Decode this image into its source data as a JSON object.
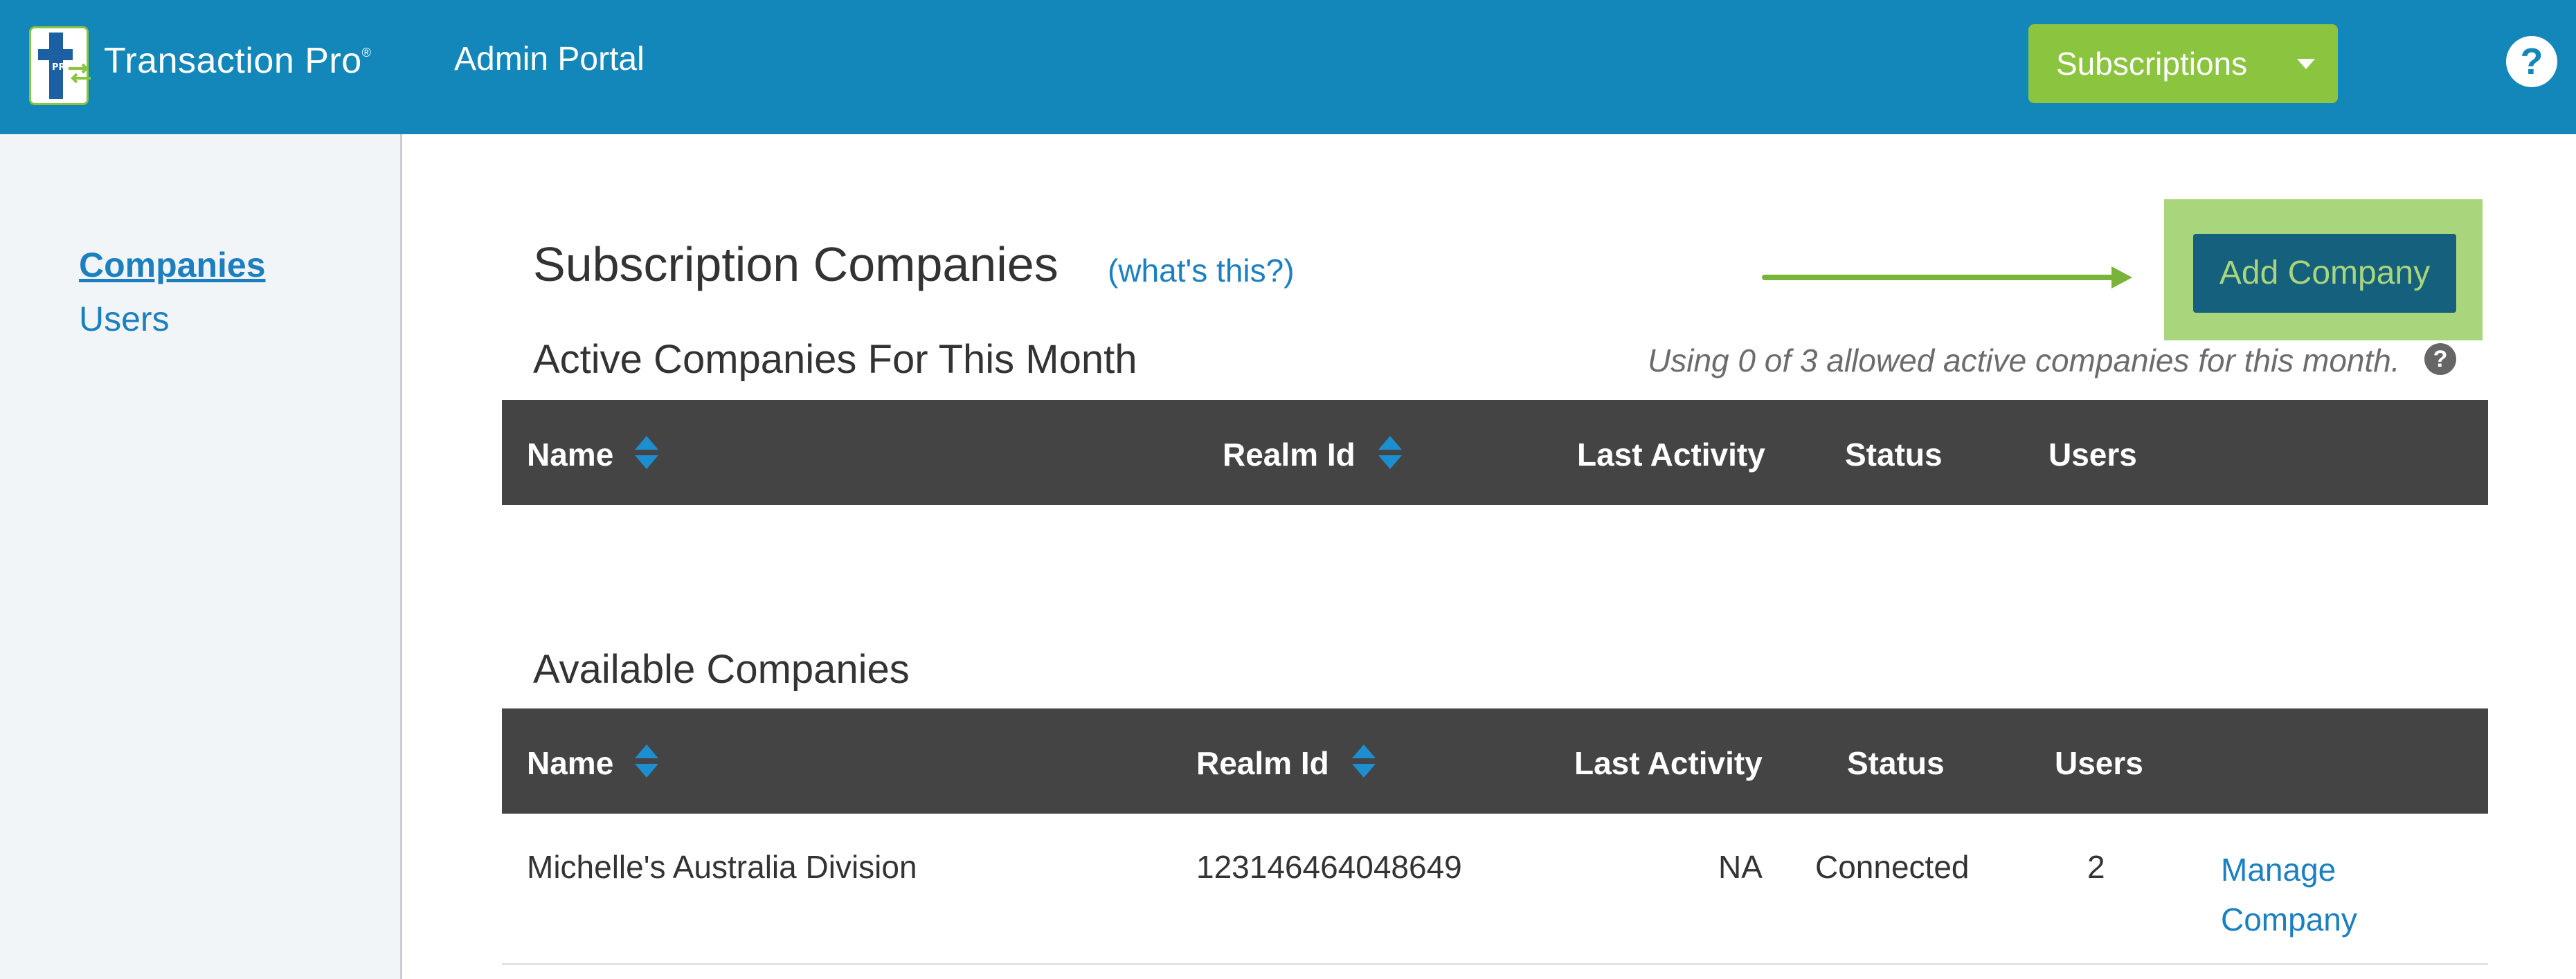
{
  "header": {
    "logo_text": "Transaction Pro",
    "logo_mark_text": "PRO",
    "trademark": "®",
    "portal_title": "Admin Portal",
    "subscriptions_label": "Subscriptions",
    "help_label": "?",
    "bar_color": "#1487ba",
    "accent_color": "#8bc43f"
  },
  "sidebar": {
    "items": [
      {
        "label": "Companies",
        "active": true
      },
      {
        "label": "Users",
        "active": false
      }
    ]
  },
  "main": {
    "title": "Subscription Companies",
    "whats_this": "(what's this?)",
    "add_company_label": "Add Company",
    "active_section": {
      "title": "Active Companies For This Month",
      "usage_note": "Using 0 of 3 allowed active companies for this month.",
      "info_icon": "?",
      "columns": [
        "Name",
        "Realm Id",
        "Last Activity",
        "Status",
        "Users"
      ],
      "rows": []
    },
    "available_section": {
      "title": "Available Companies",
      "columns": [
        "Name",
        "Realm Id",
        "Last Activity",
        "Status",
        "Users"
      ],
      "rows": [
        {
          "name": "Michelle's Australia Division",
          "realm_id": "123146464048649",
          "last_activity": "NA",
          "status": "Connected",
          "users": "2",
          "action": "Manage Company"
        }
      ]
    }
  },
  "icons": [
    "logo-icon",
    "chevron-down-icon",
    "help-icon",
    "sort-icon",
    "info-icon",
    "arrow-right-icon"
  ]
}
